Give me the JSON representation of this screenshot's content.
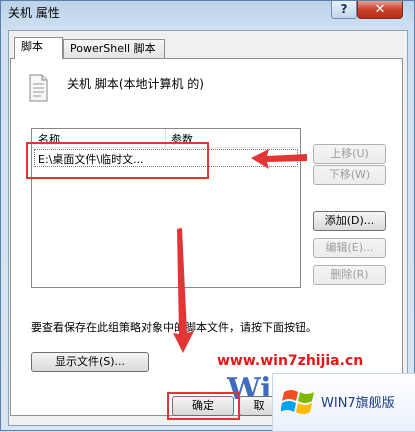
{
  "window": {
    "title": "关机 属性",
    "help_label": "?",
    "close_label": "✕"
  },
  "tabs": [
    {
      "label": "脚本"
    },
    {
      "label": "PowerShell 脚本"
    }
  ],
  "panel": {
    "header": "关机 脚本(本地计算机 的)",
    "list": {
      "columns": [
        "名称",
        "参数"
      ],
      "rows": [
        {
          "name": "E:\\桌面文件\\临时文...",
          "params": ""
        }
      ]
    },
    "buttons": {
      "up": "上移(U)",
      "down": "下移(W)",
      "add": "添加(D)...",
      "edit": "编辑(E)...",
      "remove": "删除(R)"
    },
    "footer_text": "要查看保存在此组策略对象中的脚本文件，请按下面按钮。",
    "show_files": "显示文件(S)..."
  },
  "dialog_buttons": {
    "ok": "确定",
    "cancel": "取"
  },
  "overlay": {
    "watermark_url": "www.win7zhijia.cn",
    "win_logo_text": "Win",
    "badge_text": "WIN7旗舰版",
    "badge_sub": "www.win7zhijia.cn"
  },
  "colors": {
    "annotation_red": "#e33535",
    "title_bar": "#bcd3ea",
    "close_button": "#c7412d"
  }
}
